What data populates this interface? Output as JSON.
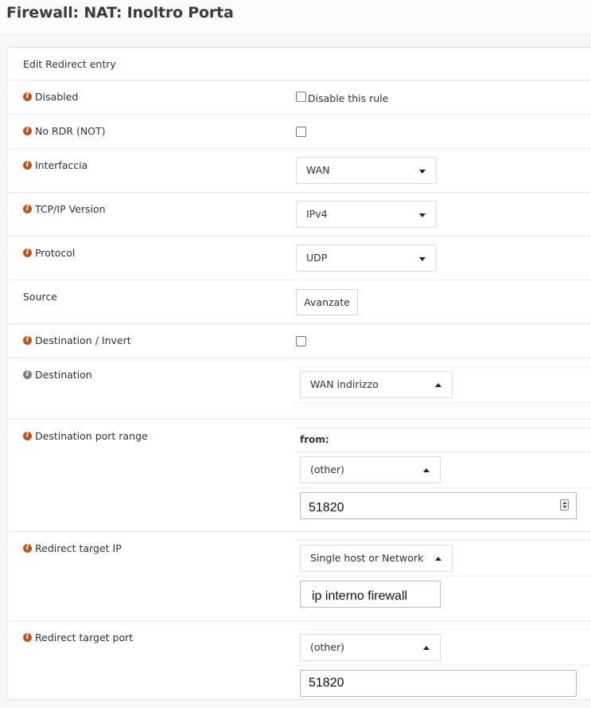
{
  "page": {
    "title": "Firewall: NAT: Inoltro Porta"
  },
  "form": {
    "section_title": "Edit Redirect entry",
    "disabled": {
      "label": "Disabled",
      "checkbox_label": "Disable this rule",
      "checked": false
    },
    "no_rdr": {
      "label": "No RDR (NOT)",
      "checked": false
    },
    "interface": {
      "label": "Interfaccia",
      "value": "WAN"
    },
    "ip_version": {
      "label": "TCP/IP Version",
      "value": "IPv4"
    },
    "protocol": {
      "label": "Protocol",
      "value": "UDP"
    },
    "source": {
      "label": "Source",
      "button": "Avanzate"
    },
    "destination_invert": {
      "label": "Destination / Invert",
      "checked": false
    },
    "destination": {
      "label": "Destination",
      "value": "WAN indirizzo"
    },
    "dest_port_range": {
      "label": "Destination port range",
      "from_label": "from:",
      "type_value": "(other)",
      "port_value": "51820"
    },
    "redirect_ip": {
      "label": "Redirect target IP",
      "type_value": "Single host or Network",
      "address_value": "ip interno firewall"
    },
    "redirect_port": {
      "label": "Redirect target port",
      "type_value": "(other)",
      "port_value": "51820"
    }
  },
  "colors": {
    "info_icon": "#c0551c",
    "info_icon_grey": "#7f7f7f"
  }
}
